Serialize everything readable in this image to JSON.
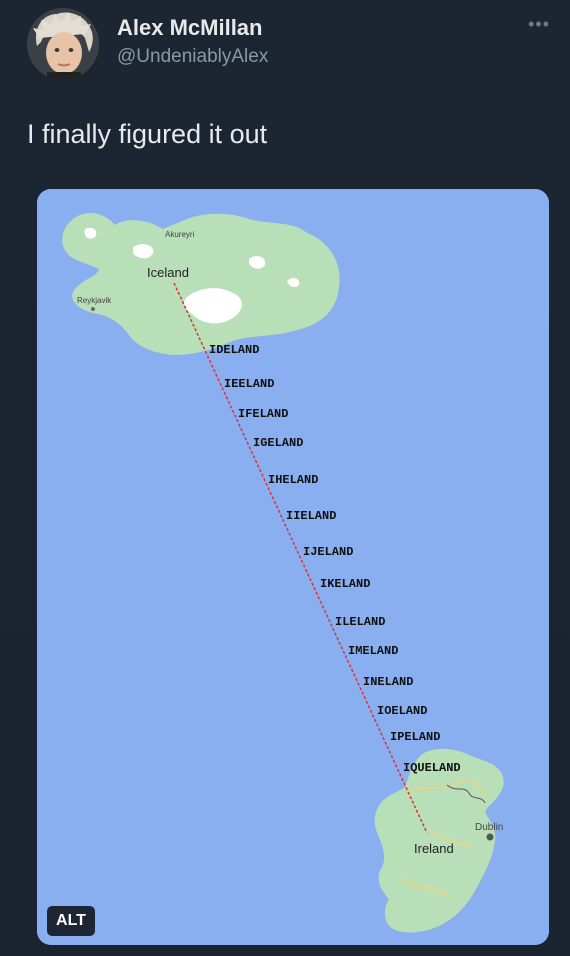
{
  "author": {
    "name": "Alex McMillan",
    "handle": "@UndeniablyAlex"
  },
  "tweet": {
    "text": "I finally figured it out"
  },
  "media": {
    "alt_label": "ALT",
    "map": {
      "start_label": "Iceland",
      "end_label": "Ireland",
      "place_labels": [
        "Akureyri",
        "Reykjavik",
        "Dublin"
      ],
      "steps": [
        "IDELAND",
        "IEELAND",
        "IFELAND",
        "IGELAND",
        "IHELAND",
        "IIELAND",
        "IJELAND",
        "IKELAND",
        "ILELAND",
        "IMELAND",
        "INELAND",
        "IOELAND",
        "IPELAND",
        "IQUELAND"
      ]
    }
  },
  "colors": {
    "background": "#1c2633",
    "ocean": "#8aaff0",
    "land": "#b9dfb8",
    "ice": "#ffffff",
    "route": "#d8343c"
  },
  "icons": {
    "more": "more-horizontal-icon"
  }
}
